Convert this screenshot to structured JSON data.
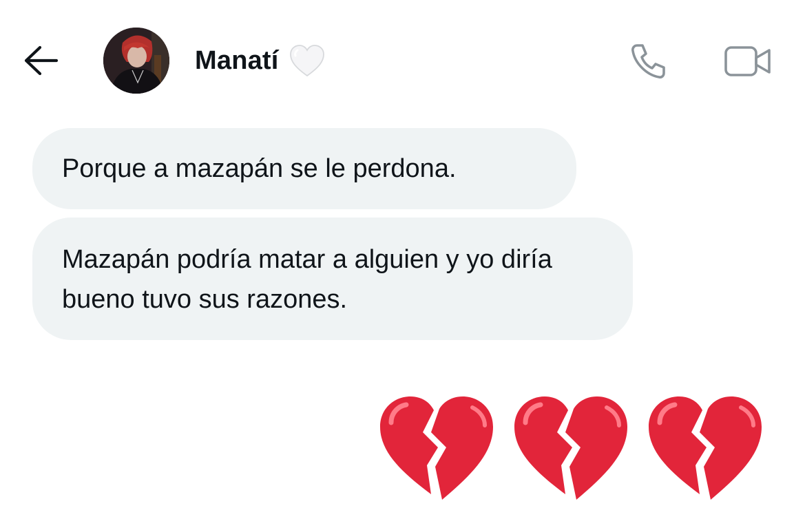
{
  "header": {
    "back_icon": "arrow-left-icon",
    "contact_name": "Manatí",
    "name_emoji": "white-heart-icon",
    "actions": [
      {
        "icon": "phone-icon"
      },
      {
        "icon": "video-camera-icon"
      }
    ]
  },
  "messages": [
    {
      "text": "Porque a mazapán se le perdona."
    },
    {
      "text": "Mazapán podría matar a alguien y yo diría bueno tuvo sus razones."
    }
  ],
  "sent": {
    "emojis": [
      "broken-heart-icon",
      "broken-heart-icon",
      "broken-heart-icon"
    ]
  },
  "colors": {
    "bubble_bg": "#eff3f4",
    "text": "#0f1419",
    "icon_gray": "#8b9399",
    "broken_heart": "#e2253a"
  }
}
